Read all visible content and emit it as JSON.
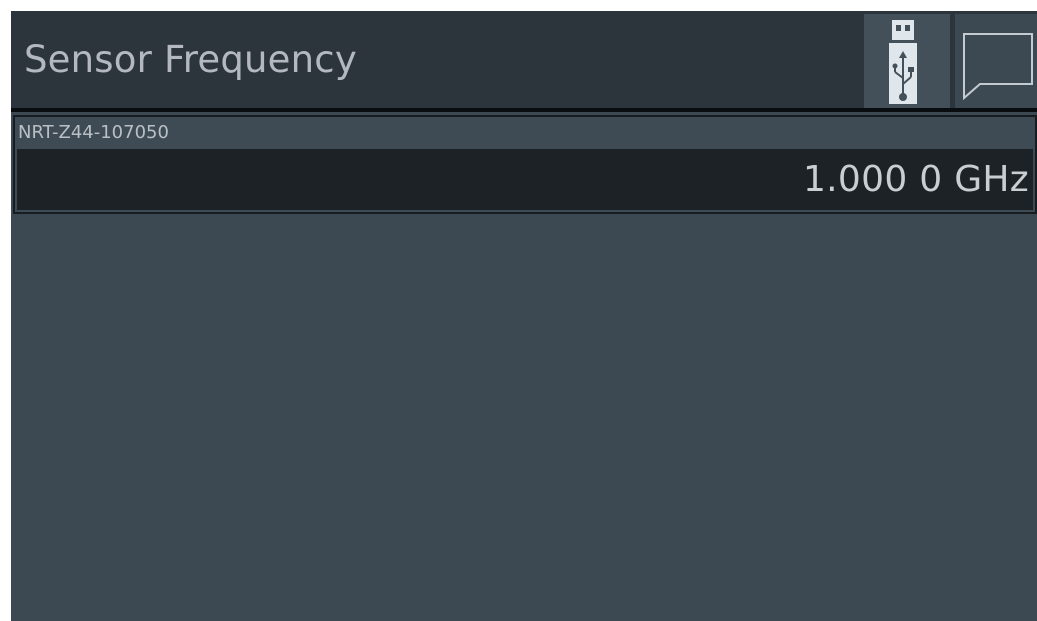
{
  "header": {
    "title": "Sensor Frequency",
    "usb_icon": "usb-stick-icon",
    "message_icon": "speech-bubble-icon"
  },
  "sensor": {
    "name": "NRT-Z44-107050",
    "frequency_value": "1.000 0",
    "frequency_unit": "GHz"
  },
  "colors": {
    "background": "#3c4852",
    "titlebar": "#2d353c",
    "value_field": "#1c2226",
    "text": "#c9ced2"
  }
}
